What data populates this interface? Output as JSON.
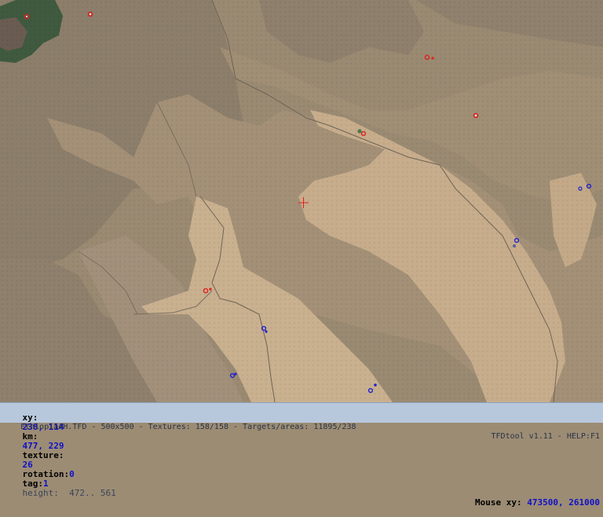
{
  "map": {
    "colors": {
      "dark_terrain": "#8d7f6b",
      "mid_terrain": "#a18f75",
      "light_terrain": "#c4ab8b",
      "forest": "#3f5a3f",
      "river": "#6e6458",
      "target_red": "#e02020",
      "target_blue": "#2020d0",
      "crosshair": "#e02020"
    }
  },
  "status": {
    "xy_label": "xy:",
    "xy_value": "238, 114",
    "km_label": "km:",
    "km_value": "477, 229",
    "texture_label": "texture:",
    "texture_value": "26",
    "rotation_label": "rotation:",
    "rotation_value": "0",
    "tag_label": "tag:",
    "tag_value": "1",
    "height_text": "height:  472.. 561",
    "mouse_label": "Mouse xy:",
    "mouse_value": "473500, 261000",
    "file_info": "EthiopiaAH.TFD - 500x500 - Textures: 158/158 - Targets/areas: 11895/238",
    "tool_info": "TFDtool v1.11 - HELP:F1"
  }
}
